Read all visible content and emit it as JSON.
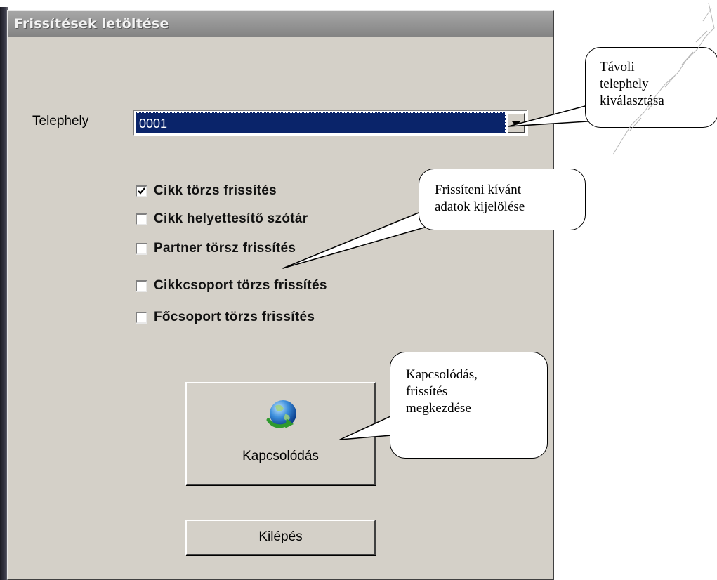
{
  "window": {
    "title": "Frissítések letöltése"
  },
  "form": {
    "site_label": "Telephely",
    "site_value": "0001",
    "checkboxes": [
      {
        "label": "Cikk törzs frissítés",
        "checked": true
      },
      {
        "label": "Cikk helyettesítő szótár",
        "checked": false
      },
      {
        "label": "Partner törsz frissítés",
        "checked": false
      },
      {
        "label": "Cikkcsoport törzs frissítés",
        "checked": false
      },
      {
        "label": "Főcsoport törzs frissítés",
        "checked": false
      }
    ],
    "connect_label": "Kapcsolódás",
    "exit_label": "Kilépés"
  },
  "callouts": {
    "remote_site": [
      "Távoli",
      "telephely",
      "kiválasztása"
    ],
    "select_data": [
      "Frissíteni kívánt",
      "adatok kijelölése"
    ],
    "connect": [
      "Kapcsolódás,",
      "frissítés",
      "megkezdése"
    ]
  },
  "icons": {
    "dropdown": "chevron-down-icon",
    "check": "checkmark-icon",
    "connect": "globe-icon"
  },
  "colors": {
    "dialog_bg": "#d4d0c8",
    "selection": "#0a246a",
    "title_bar": "#949494"
  }
}
